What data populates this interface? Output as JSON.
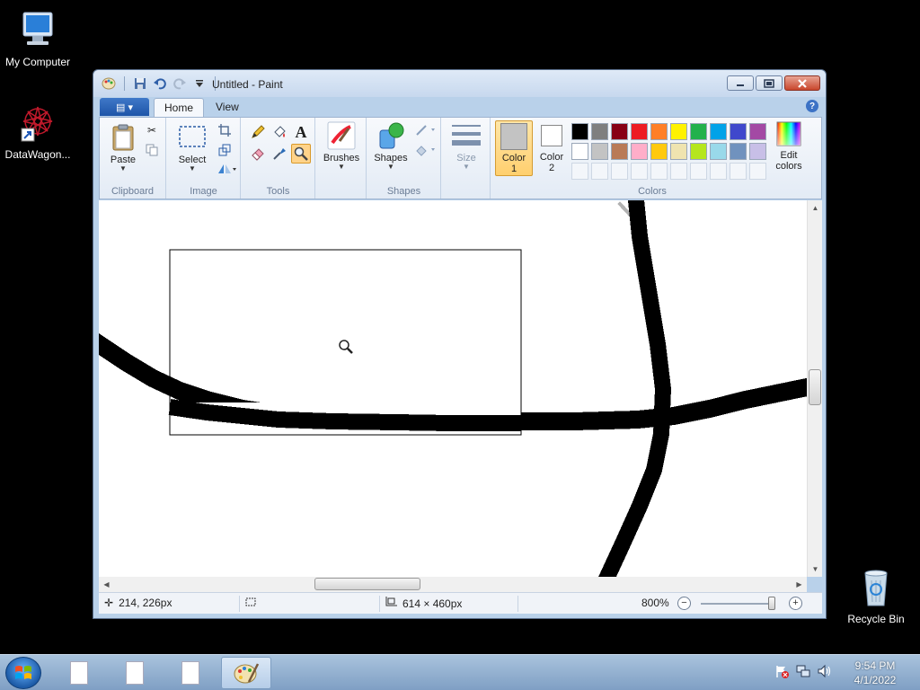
{
  "desktop": {
    "icons": [
      {
        "label": "My Computer"
      },
      {
        "label": "DataWagon..."
      },
      {
        "label": "Recycle Bin"
      }
    ]
  },
  "window": {
    "title": "Untitled - Paint",
    "tabs": {
      "file": "▤ ▾",
      "home": "Home",
      "view": "View"
    },
    "help": "?",
    "ribbon": {
      "clipboard": {
        "label": "Clipboard",
        "paste": "Paste"
      },
      "image": {
        "label": "Image",
        "select": "Select"
      },
      "tools": {
        "label": "Tools",
        "text_tool": "A"
      },
      "brushes": {
        "label": "Brushes"
      },
      "shapes": {
        "label": "Shapes",
        "shapes_btn": "Shapes"
      },
      "size": {
        "label": "Size"
      },
      "color1": {
        "line1": "Color",
        "line2": "1"
      },
      "color2": {
        "line1": "Color",
        "line2": "2"
      },
      "colors": {
        "label": "Colors",
        "row1": [
          "#000000",
          "#7f7f7f",
          "#880015",
          "#ed1c24",
          "#ff7f27",
          "#fff200",
          "#22b14c",
          "#00a2e8",
          "#3f48cc",
          "#a349a4"
        ],
        "row2": [
          "#ffffff",
          "#c3c3c3",
          "#b97a57",
          "#ffaec9",
          "#ffc90e",
          "#efe4b0",
          "#b5e61d",
          "#99d9ea",
          "#7092be",
          "#c8bfe7"
        ]
      },
      "edit_colors": {
        "line1": "Edit",
        "line2": "colors"
      }
    },
    "status": {
      "cursor_pos": "214, 226px",
      "image_size": "614 × 460px",
      "zoom": "800%"
    }
  },
  "taskbar": {
    "time": "9:54 PM",
    "date": "4/1/2022"
  }
}
